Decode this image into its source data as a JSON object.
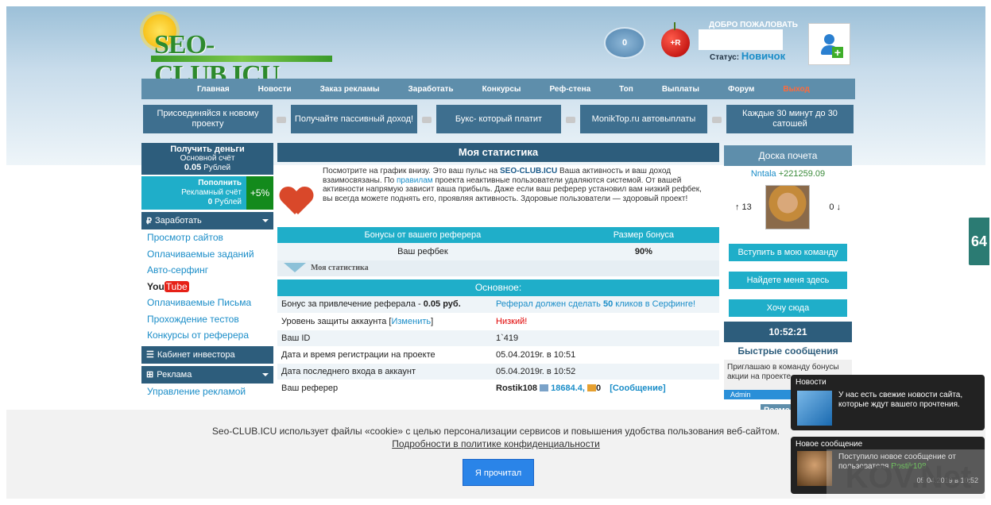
{
  "header": {
    "logo_text": "SEO-CLUB.ICU",
    "counter": "0",
    "cherry_label": "+R",
    "welcome": "ДОБРО ПОЖАЛОВАТЬ",
    "status_label": "Статус:",
    "status_value": "Новичок"
  },
  "nav": [
    "Главная",
    "Новости",
    "Заказ рекламы",
    "Заработать",
    "Конкурсы",
    "Реф-стена",
    "Топ",
    "Выплаты",
    "Форум",
    "Выход"
  ],
  "promos": [
    "Присоединяйся к новому проекту",
    "Получайте пассивный доход!",
    "Букс- который платит",
    "MonikTop.ru автовыплаты",
    "Каждые 30 минут до 30 сатошей"
  ],
  "left": {
    "get_money": "Получить деньги",
    "main_account": "Основной счёт",
    "main_balance": "0.05",
    "currency": "Рублей",
    "refill": "Пополнить",
    "ad_account": "Рекламный счёт",
    "ad_balance": "0",
    "bonus": "+5%",
    "earn_title": "Заработать",
    "earn_items": [
      "Просмотр сайтов",
      "Оплачиваемые заданий",
      "Авто-серфинг",
      "Оплачиваемые Письма",
      "Прохождение тестов",
      "Конкурсы от реферера"
    ],
    "youtube_a": "You",
    "youtube_b": "Tube",
    "investor": "Кабинет инвестора",
    "ads_title": "Реклама",
    "ads_item": "Управление рекламой"
  },
  "center": {
    "title": "Моя статистика",
    "intro_1": "Посмотрите на график внизу. Это ваш пульс на",
    "intro_site": "SEO-CLUB.ICU",
    "intro_2": "Ваша активность и ваш доход взаимосвязаны. По",
    "intro_link": "правилам",
    "intro_3": "проекта неактивные пользователи удаляются системой. От вашей активности напрямую зависит ваша прибыль. Даже если ваш реферер установил вам низкий рефбек, вы всегда можете поднять его, проявляя активность. Здоровые пользователи — здоровый проект!",
    "bonus_head_1": "Бонусы от вашего реферера",
    "bonus_head_2": "Размер бонуса",
    "refback_label": "Ваш рефбек",
    "refback_value": "90%",
    "fold_label": "Моя статистика",
    "basic": "Основное:",
    "rows": [
      {
        "k": "Бонус за привлечение реферала -",
        "kb": "0.05 руб.",
        "v": "Реферал должен сделать",
        "vb": "50",
        "v2": "кликов в Серфинге!"
      },
      {
        "k": "Уровень защиты аккаунта [",
        "kl": "Изменить",
        "k2": "]",
        "v": "Низкий!"
      },
      {
        "k": "Ваш ID",
        "v": "1`419"
      },
      {
        "k": "Дата и время регистрации на проекте",
        "v": "05.04.2019г. в 10:51"
      },
      {
        "k": "Дата последнего входа в аккаунт",
        "v": "05.04.2019г. в 10:52"
      },
      {
        "k": "Ваш реферер",
        "v": "Rostik108",
        "v_n1": "18684.4,",
        "v_n2": "0",
        "v_link": "[Сообщение]"
      }
    ]
  },
  "right": {
    "honor": "Доска почета",
    "user": "Nntala",
    "user_score": "+221259.09",
    "up": "↑ 13",
    "down": "0 ↓",
    "btn1": "Вступить в мою команду",
    "btn2": "Найдете меня здесь",
    "btn3": "Хочу сюда",
    "time": "10:52:21",
    "fast": "Быстрые сообщения",
    "chat": "Приглашаю в команду бонусы акции на проекте",
    "chat_user": "Admin",
    "cut": "Разме"
  },
  "side_tab": "64",
  "cookie": {
    "text": "Seo-CLUB.ICU использует файлы «cookie» с целью персонализации сервисов и повышения удобства пользования веб-сайтом.",
    "link": "Подробности в политике конфиденциальности",
    "button": "Я прочитал"
  },
  "toast1": {
    "title": "Новости",
    "msg": "У нас есть свежие новости сайта, которые ждут вашего прочтения."
  },
  "toast2": {
    "title": "Новое сообщение",
    "msg": "Поступило новое сообщение от пользователя",
    "user": "Rostik108",
    "date": "05.04.2019 в 10:52"
  },
  "watermark": "KOV.Net"
}
